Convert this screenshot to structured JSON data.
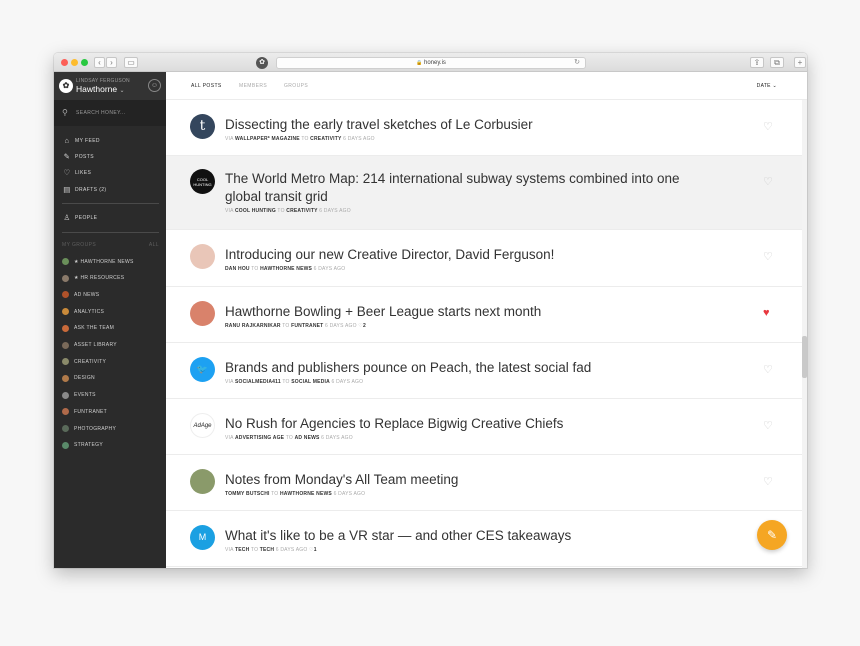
{
  "browser": {
    "url": "honey.is",
    "lock_icon": "lock-icon"
  },
  "sidebar": {
    "user_name": "LINDSAY FERGUSON",
    "org_name": "Hawthorne",
    "search_placeholder": "SEARCH HONEY...",
    "nav": [
      {
        "label": "MY FEED",
        "icon": "home-icon"
      },
      {
        "label": "POSTS",
        "icon": "edit-icon"
      },
      {
        "label": "LIKES",
        "icon": "heart-icon"
      },
      {
        "label": "DRAFTS (2)",
        "icon": "draft-icon"
      }
    ],
    "people_label": "PEOPLE",
    "groups_header": "MY GROUPS",
    "groups_all": "ALL",
    "groups": [
      {
        "label": "★ HAWTHORNE NEWS",
        "color": "#6a8f5a"
      },
      {
        "label": "★ HR RESOURCES",
        "color": "#8a7a6a"
      },
      {
        "label": "AD NEWS",
        "color": "#b0522a"
      },
      {
        "label": "ANALYTICS",
        "color": "#c98a3a"
      },
      {
        "label": "ASK THE TEAM",
        "color": "#c96a3a"
      },
      {
        "label": "ASSET LIBRARY",
        "color": "#7a6a5a"
      },
      {
        "label": "CREATIVITY",
        "color": "#8a8a6a"
      },
      {
        "label": "DESIGN",
        "color": "#b07a4a"
      },
      {
        "label": "EVENTS",
        "color": "#8a8a8a"
      },
      {
        "label": "FUNTRANET",
        "color": "#b06a4a"
      },
      {
        "label": "PHOTOGRAPHY",
        "color": "#5a6a5a"
      },
      {
        "label": "STRATEGY",
        "color": "#5a8a6a"
      }
    ]
  },
  "main": {
    "tabs": [
      {
        "label": "ALL POSTS",
        "active": true
      },
      {
        "label": "MEMBERS",
        "active": false
      },
      {
        "label": "GROUPS",
        "active": false
      }
    ],
    "sort_label": "DATE ⌄",
    "posts": [
      {
        "title": "Dissecting the early travel sketches of Le Corbusier",
        "via": "VIA",
        "source": "WALLPAPER* MAGAZINE",
        "to": "TO",
        "group": "CREATIVITY",
        "time": "6 DAYS AGO",
        "comments": "",
        "liked": false,
        "avatar_text": "t",
        "avatar_color": "#34465d"
      },
      {
        "title": "The World Metro Map: 214 international subway systems combined into one global transit grid",
        "via": "VIA",
        "source": "COOL HUNTING",
        "to": "TO",
        "group": "CREATIVITY",
        "time": "6 DAYS AGO",
        "comments": "",
        "liked": false,
        "avatar_text": "COOL HUNTING",
        "avatar_color": "#111111"
      },
      {
        "title": "Introducing our new Creative Director, David Ferguson!",
        "via": "",
        "source": "DAN HOU",
        "to": "TO",
        "group": "HAWTHORNE NEWS",
        "time": "6 DAYS AGO",
        "comments": "",
        "liked": false,
        "avatar_text": "",
        "avatar_color": "#e9c6b8"
      },
      {
        "title": "Hawthorne Bowling + Beer League starts next month",
        "via": "",
        "source": "RANU RAJKARNIKAR",
        "to": "TO",
        "group": "FUNTRANET",
        "time": "6 DAYS AGO",
        "comments": "2",
        "liked": true,
        "avatar_text": "",
        "avatar_color": "#d9826b"
      },
      {
        "title": "Brands and publishers pounce on Peach, the latest social fad",
        "via": "VIA",
        "source": "SOCIALMEDIA411",
        "to": "TO",
        "group": "SOCIAL MEDIA",
        "time": "6 DAYS AGO",
        "comments": "",
        "liked": false,
        "avatar_text": "🐦",
        "avatar_color": "#1da1f2"
      },
      {
        "title": "No Rush for Agencies to Replace Bigwig Creative Chiefs",
        "via": "VIA",
        "source": "ADVERTISING AGE",
        "to": "TO",
        "group": "AD NEWS",
        "time": "6 DAYS AGO",
        "comments": "",
        "liked": false,
        "avatar_text": "AdAge",
        "avatar_color": "#ffffff"
      },
      {
        "title": "Notes from Monday's All Team meeting",
        "via": "",
        "source": "TOMMY BUTSCHI",
        "to": "TO",
        "group": "HAWTHORNE NEWS",
        "time": "6 DAYS AGO",
        "comments": "",
        "liked": false,
        "avatar_text": "",
        "avatar_color": "#8a9a6a"
      },
      {
        "title": "What it's like to be a VR star — and other CES takeaways",
        "via": "VIA",
        "source": "TECH",
        "to": "TO",
        "group": "TECH",
        "time": "6 DAYS AGO",
        "comments": "1",
        "liked": false,
        "avatar_text": "M",
        "avatar_color": "#1ba0e2"
      }
    ]
  }
}
